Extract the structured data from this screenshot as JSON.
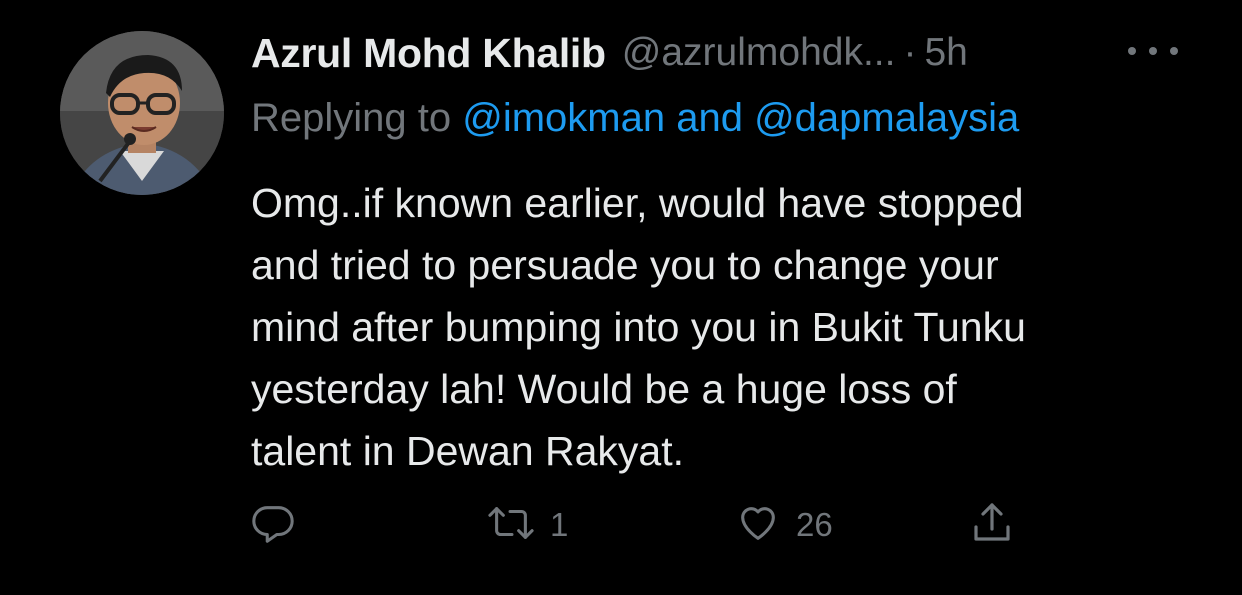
{
  "author": {
    "name": "Azrul Mohd Khalib",
    "handle": "@azrulmohdk...",
    "separator": "·",
    "time": "5h"
  },
  "reply": {
    "prefix": "Replying to ",
    "mentions": "@imokman and @dapmalaysia"
  },
  "tweet": {
    "text": "Omg..if known earlier, would have stopped\nand tried to persuade you to change your\nmind after bumping into you in Bukit Tunku\nyesterday lah! Would be a huge loss of\ntalent in Dewan Rakyat."
  },
  "actions": {
    "reply_count": "",
    "retweet_count": "1",
    "like_count": "26"
  },
  "colors": {
    "background": "#000000",
    "text": "#e7e9ea",
    "muted": "#71767b",
    "accent": "#1d9bf0"
  },
  "icons": [
    "reply-icon",
    "retweet-icon",
    "like-icon",
    "share-icon",
    "more-icon"
  ]
}
